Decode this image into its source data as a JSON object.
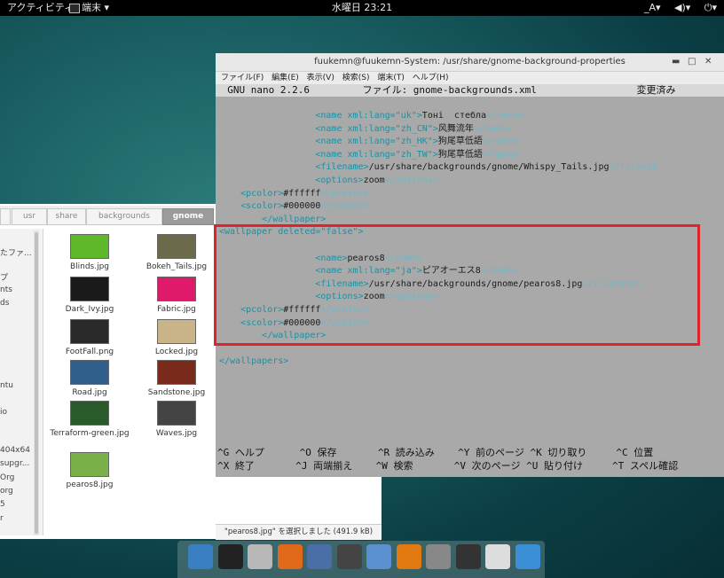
{
  "topbar": {
    "activities": "アクティビティ",
    "app": "端末 ▾",
    "clock": "水曜日 23:21",
    "lang": "_A▾",
    "volume": "◀)▾",
    "power": "⏻▾"
  },
  "file_manager": {
    "breadcrumbs": [
      "usr",
      "share",
      "backgrounds",
      "gnome"
    ],
    "sidebar": [
      "たファ...",
      "プ",
      "nts",
      "ds",
      "",
      "ntu",
      "io",
      "404x64",
      "supgr...",
      "Org",
      "org",
      "5",
      "r"
    ],
    "files": [
      {
        "name": "Blinds.jpg",
        "color": "#5fb82a"
      },
      {
        "name": "Bokeh_Tails.jpg",
        "color": "#6b6a4a"
      },
      {
        "name": "Dark_Ivy.jpg",
        "color": "#1a1a1a"
      },
      {
        "name": "Fabric.jpg",
        "color": "#e01a6a"
      },
      {
        "name": "FootFall.png",
        "color": "#2a2a2a"
      },
      {
        "name": "Locked.jpg",
        "color": "#c9b48a"
      },
      {
        "name": "Road.jpg",
        "color": "#2f5f8a"
      },
      {
        "name": "Sandstone.jpg",
        "color": "#7a2a1a"
      },
      {
        "name": "Terraform-green.jpg",
        "color": "#2a5a2a"
      },
      {
        "name": "Waves.jpg",
        "color": "#444"
      },
      {
        "name": "pearos8.jpg",
        "color": "#7ab04a"
      }
    ],
    "status": "\"pearos8.jpg\" を選択しました (491.9 kB)"
  },
  "terminal": {
    "title": "fuukemn@fuukemn-System: /usr/share/gnome-background-properties",
    "menu": [
      "ファイル(F)",
      "編集(E)",
      "表示(V)",
      "検索(S)",
      "端末(T)",
      "ヘルプ(H)"
    ],
    "nano_header": "  GNU nano 2.2.6         ファイル: gnome-backgrounds.xml                 変更済み",
    "lines": [
      {
        "pre": "                  ",
        "tag1": "<name xml:lang=\"uk\">",
        "text": "Тоні  стебла",
        "tag2": "</name>"
      },
      {
        "pre": "                  ",
        "tag1": "<name xml:lang=\"zh_CN\">",
        "text": "风舞流年",
        "tag2": "</name>"
      },
      {
        "pre": "                  ",
        "tag1": "<name xml:lang=\"zh_HK\">",
        "text": "狗尾草低語",
        "tag2": "</name>"
      },
      {
        "pre": "                  ",
        "tag1": "<name xml:lang=\"zh_TW\">",
        "text": "狗尾草低語",
        "tag2": "</name>"
      },
      {
        "pre": "                  ",
        "tag1": "<filename>",
        "text": "/usr/share/backgrounds/gnome/Whispy_Tails.jpg",
        "tag2": "</filena$"
      },
      {
        "pre": "                  ",
        "tag1": "<options>",
        "text": "zoom",
        "tag2": "</options>"
      },
      {
        "pre": "    ",
        "tag1": "<pcolor>",
        "text": "#ffffff",
        "tag2": "</pcolor>"
      },
      {
        "pre": "    ",
        "tag1": "<scolor>",
        "text": "#000000",
        "tag2": "</scolor>"
      },
      {
        "pre": "        ",
        "tag1": "</wallpaper>",
        "text": "",
        "tag2": ""
      },
      {
        "pre": "",
        "tag1": "<wallpaper deleted=\"false\">",
        "text": "",
        "tag2": ""
      },
      {
        "pre": "",
        "tag1": "",
        "text": "",
        "tag2": ""
      },
      {
        "pre": "                  ",
        "tag1": "<name>",
        "text": "pearos8",
        "tag2": "</name>"
      },
      {
        "pre": "                  ",
        "tag1": "<name xml:lang=\"ja\">",
        "text": "ピアオーエス8",
        "tag2": "</name>"
      },
      {
        "pre": "                  ",
        "tag1": "<filename>",
        "text": "/usr/share/backgrounds/gnome/pearos8.jpg",
        "tag2": "</filename>"
      },
      {
        "pre": "                  ",
        "tag1": "<options>",
        "text": "zoom",
        "tag2": "</options>"
      },
      {
        "pre": "    ",
        "tag1": "<pcolor>",
        "text": "#ffffff",
        "tag2": "</pcolor>"
      },
      {
        "pre": "    ",
        "tag1": "<scolor>",
        "text": "#000000",
        "tag2": "</scolor>"
      },
      {
        "pre": "        ",
        "tag1": "</wallpaper>",
        "text": "",
        "tag2": ""
      },
      {
        "pre": "",
        "tag1": "",
        "text": "",
        "tag2": ""
      },
      {
        "pre": "",
        "tag1": "</wallpapers>",
        "text": "",
        "tag2": ""
      }
    ],
    "footer1": "^G ヘルプ      ^O 保存       ^R 読み込み    ^Y 前のページ ^K 切り取り     ^C 位置",
    "footer2": "^X 終了       ^J 両端揃え    ^W 検索       ^V 次のページ ^U 貼り付け     ^T スペル確認"
  },
  "dock": {
    "icons": [
      "anchor-icon",
      "terminal-icon",
      "files-icon",
      "firefox-icon",
      "mail-icon",
      "speaker-icon",
      "chat-icon",
      "vlc-icon",
      "mixer-icon",
      "disk-icon",
      "trash-icon",
      "window-icon"
    ]
  },
  "colors": {
    "highlight_border": "#e0232a",
    "terminal_bg": "#a9a9a9",
    "xml_tag": "#1f8fa0"
  }
}
